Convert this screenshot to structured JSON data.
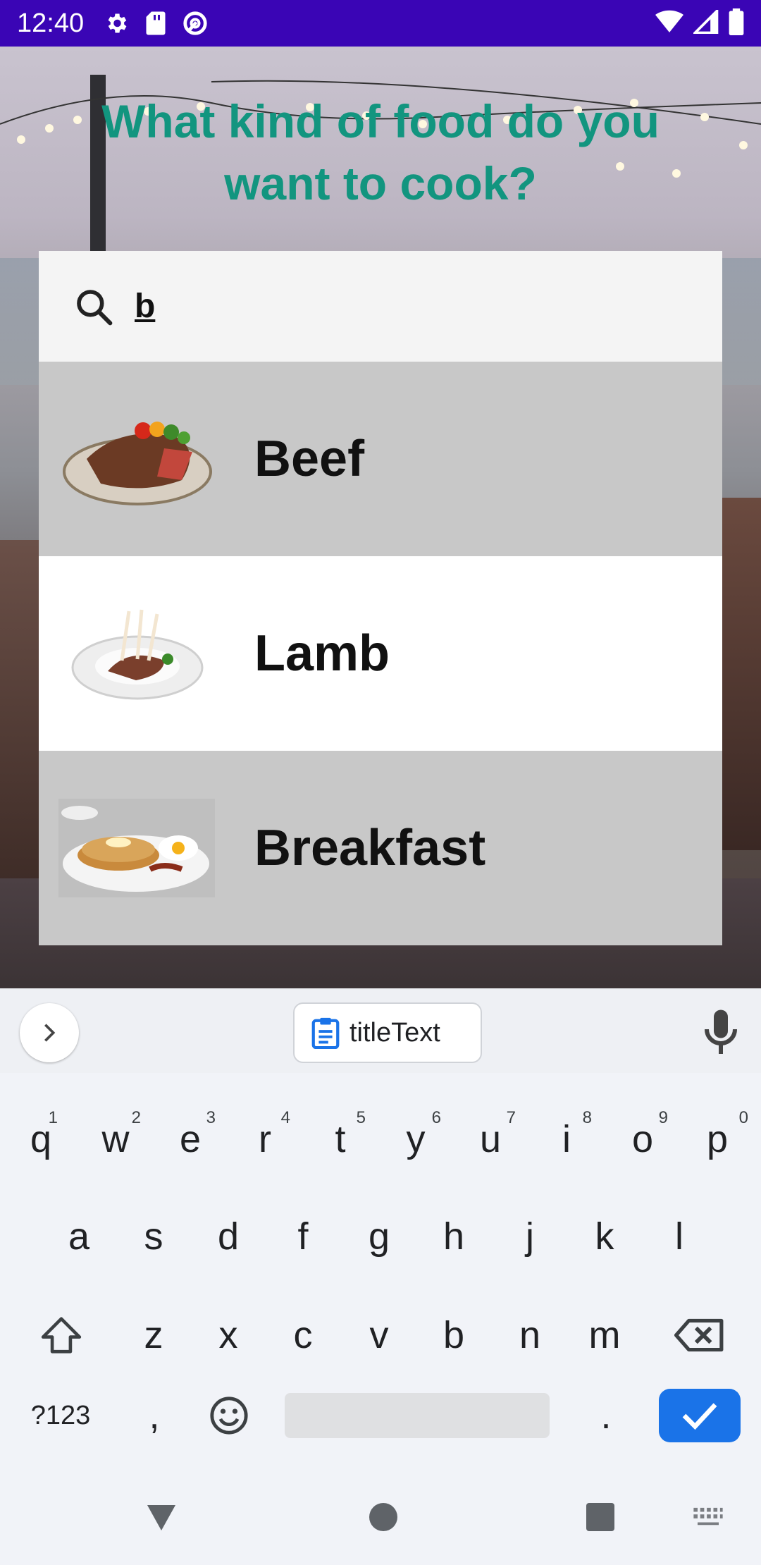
{
  "status_bar": {
    "time": "12:40",
    "icons": [
      "gear-icon",
      "sd-card-icon",
      "sync-icon"
    ],
    "right_icons": [
      "wifi-icon",
      "signal-icon",
      "battery-icon"
    ],
    "background": "#3a05b5"
  },
  "screen": {
    "headline": "What kind of food do you want to cook?",
    "headline_color": "#12957f",
    "search": {
      "query": "b",
      "icon": "search-icon"
    },
    "results": [
      {
        "label": "Beef",
        "image": "steak-image",
        "highlighted": true
      },
      {
        "label": "Lamb",
        "image": "lamb-chops-image",
        "highlighted": false
      },
      {
        "label": "Breakfast",
        "image": "pancakes-eggs-image",
        "highlighted": true
      }
    ]
  },
  "keyboard": {
    "suggestion_chip": "titleText",
    "row1": [
      {
        "key": "q",
        "hint": "1"
      },
      {
        "key": "w",
        "hint": "2"
      },
      {
        "key": "e",
        "hint": "3"
      },
      {
        "key": "r",
        "hint": "4"
      },
      {
        "key": "t",
        "hint": "5"
      },
      {
        "key": "y",
        "hint": "6"
      },
      {
        "key": "u",
        "hint": "7"
      },
      {
        "key": "i",
        "hint": "8"
      },
      {
        "key": "o",
        "hint": "9"
      },
      {
        "key": "p",
        "hint": "0"
      }
    ],
    "row2": [
      "a",
      "s",
      "d",
      "f",
      "g",
      "h",
      "j",
      "k",
      "l"
    ],
    "row3": [
      "z",
      "x",
      "c",
      "v",
      "b",
      "n",
      "m"
    ],
    "symbols_key": "?123",
    "comma_key": ",",
    "period_key": ".",
    "accent_color": "#1a73e8"
  },
  "nav_bar": {
    "buttons": [
      "back-icon",
      "home-icon",
      "recents-icon",
      "keyboard-switch-icon"
    ]
  }
}
